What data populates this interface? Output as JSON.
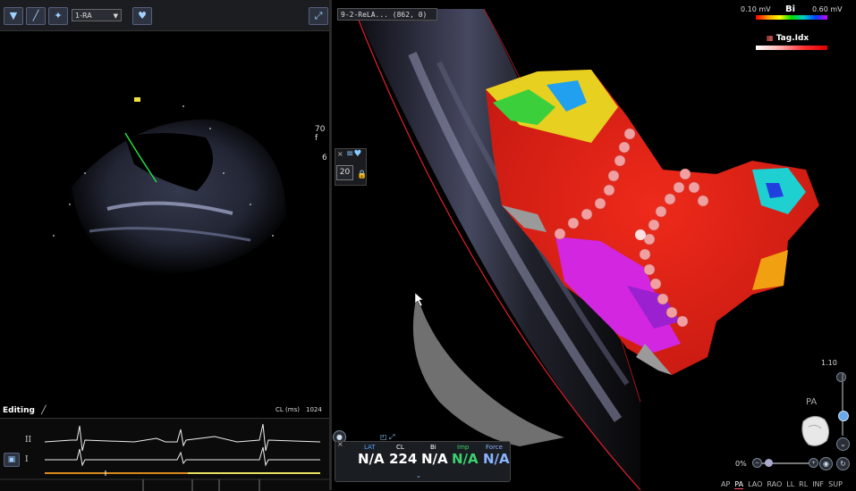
{
  "left": {
    "view_select": "1-RA",
    "depth_label_1": "70 f",
    "depth_label_2": "6",
    "editing_label": "Editing",
    "cl_label": "CL (ms)",
    "cl_value": "1024",
    "leads": [
      "II",
      "I"
    ]
  },
  "right": {
    "map_title": "9-2-ReLA... (862, 0)",
    "bi_legend": {
      "min": "0.10 mV",
      "name": "Bi",
      "max": "0.60 mV"
    },
    "tag_legend": "Tag.Idx",
    "side_number": "20",
    "readout": [
      {
        "label": "LAT",
        "value": "N/A",
        "color": "#4fa3ff",
        "value_color": "#ffffff"
      },
      {
        "label": "CL",
        "value": "224",
        "color": "#ffffff",
        "value_color": "#ffffff"
      },
      {
        "label": "Bi",
        "value": "N/A",
        "color": "#ffffff",
        "value_color": "#ffffff"
      },
      {
        "label": "Imp",
        "value": "N/A",
        "color": "#3bd16f",
        "value_color": "#3bd16f"
      },
      {
        "label": "Force",
        "value": "N/A",
        "color": "#8ab4ff",
        "value_color": "#8ab4ff"
      }
    ],
    "zoom_value": "1.10",
    "orientation_label": "PA",
    "opacity_label": "0%",
    "view_buttons": [
      "AP",
      "PA",
      "LAO",
      "RAO",
      "LL",
      "RL",
      "INF",
      "SUP"
    ],
    "active_view": "PA"
  },
  "colors": {
    "accent": "#4fa3ff",
    "boundary": "#e0202a",
    "imp": "#3bd16f"
  }
}
